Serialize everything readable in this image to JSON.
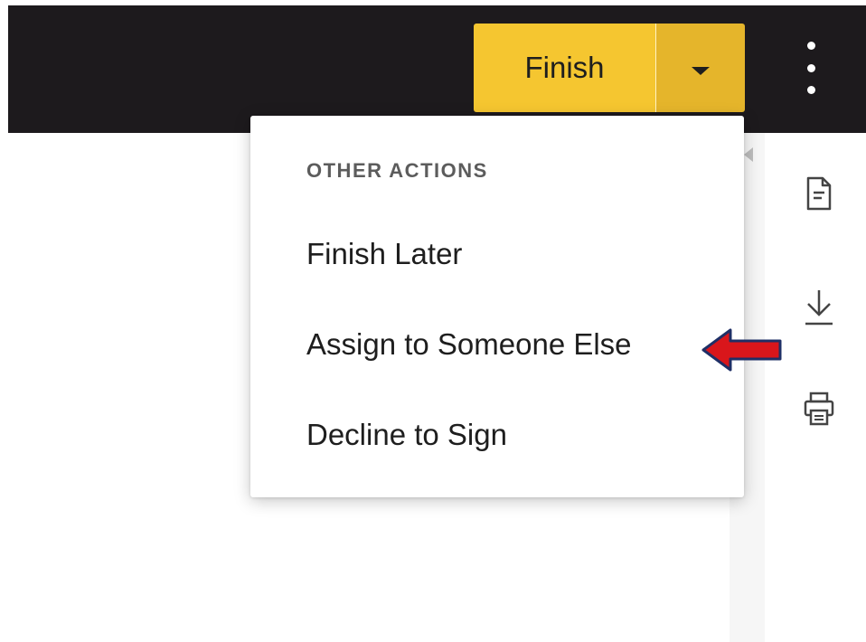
{
  "toolbar": {
    "finish_label": "Finish",
    "finish_color": "#f5c630",
    "bar_color": "#1d1a1d"
  },
  "menu": {
    "header": "OTHER ACTIONS",
    "items": [
      {
        "label": "Finish Later"
      },
      {
        "label": "Assign to Someone Else",
        "highlighted": true
      },
      {
        "label": "Decline to Sign"
      }
    ]
  },
  "right_rail": {
    "icons": [
      "document-icon",
      "download-icon",
      "print-icon"
    ]
  },
  "annotation": {
    "icon": "red-arrow-icon",
    "color": "#d9161b",
    "target": "Assign to Someone Else"
  }
}
